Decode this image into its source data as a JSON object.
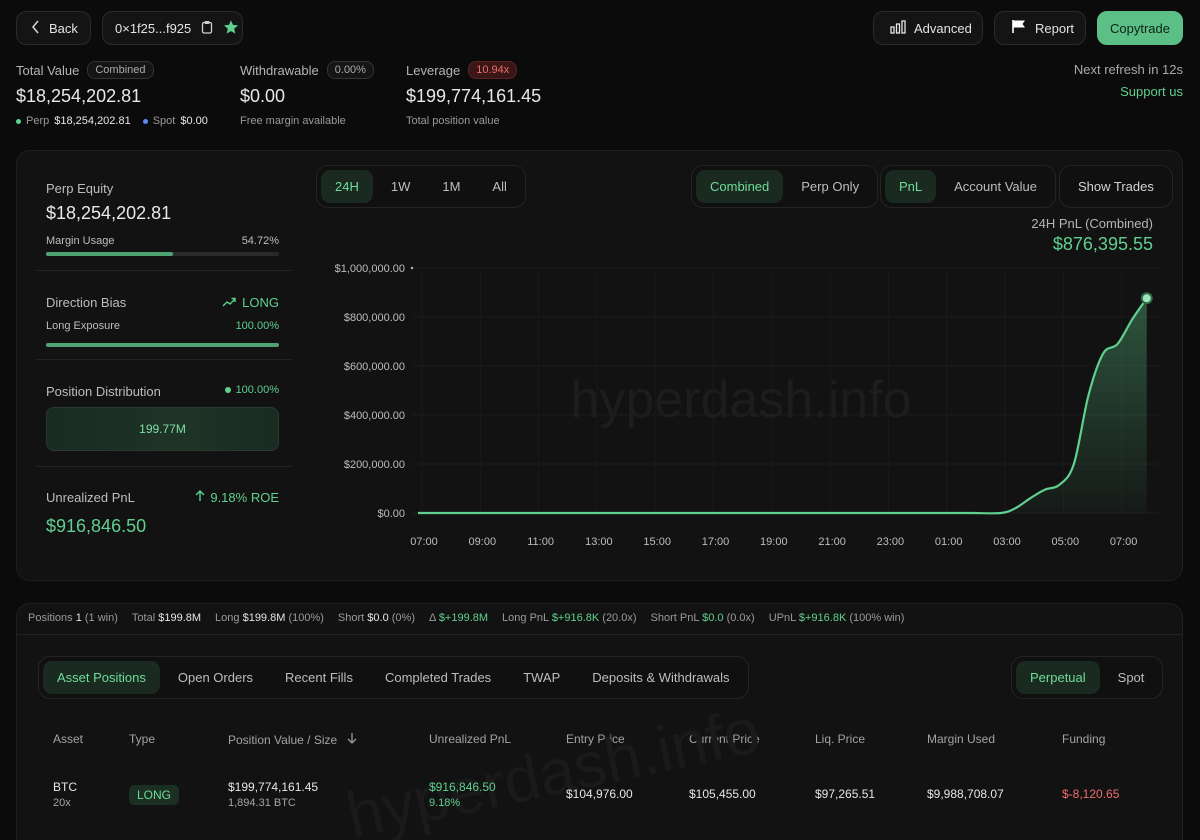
{
  "header": {
    "back_label": "Back",
    "address": "0×1f25...f925",
    "advanced_label": "Advanced",
    "report_label": "Report",
    "copytrade_label": "Copytrade"
  },
  "summary": {
    "total_value_label": "Total Value",
    "total_value_pill": "Combined",
    "total_value": "$18,254,202.81",
    "perp_label": "Perp",
    "perp_value": "$18,254,202.81",
    "spot_label": "Spot",
    "spot_value": "$0.00",
    "withdrawable_label": "Withdrawable",
    "withdrawable_pill": "0.00%",
    "withdrawable_value": "$0.00",
    "withdrawable_sub": "Free margin available",
    "leverage_label": "Leverage",
    "leverage_pill": "10.94x",
    "leverage_value": "$199,774,161.45",
    "leverage_sub": "Total position value",
    "refresh_text": "Next refresh in 12s",
    "support_text": "Support us"
  },
  "left_panel": {
    "perp_equity_label": "Perp Equity",
    "perp_equity_value": "$18,254,202.81",
    "margin_usage_label": "Margin Usage",
    "margin_usage_value": "54.72%",
    "margin_usage_fraction": 0.5472,
    "direction_bias_label": "Direction Bias",
    "direction_bias_value": "LONG",
    "long_exposure_label": "Long Exposure",
    "long_exposure_value": "100.00%",
    "long_exposure_fraction": 1.0,
    "position_distribution_label": "Position Distribution",
    "position_distribution_pct": "100.00%",
    "position_distribution_value": "199.77M",
    "unrealized_pnl_label": "Unrealized PnL",
    "unrealized_roe": "9.18% ROE",
    "unrealized_pnl_value": "$916,846.50"
  },
  "chart_controls": {
    "ranges": [
      "24H",
      "1W",
      "1M",
      "All"
    ],
    "active_range": "24H",
    "modes": [
      "Combined",
      "Perp Only"
    ],
    "active_mode": "Combined",
    "metrics": [
      "PnL",
      "Account Value"
    ],
    "active_metric": "PnL",
    "show_trades_label": "Show Trades",
    "pnl_title": "24H PnL (Combined)",
    "pnl_value": "$876,395.55",
    "watermark": "hyperdash.info"
  },
  "chart_data": {
    "type": "area",
    "x": [
      "07:00",
      "07:30",
      "08:00",
      "09:00",
      "10:00",
      "11:00",
      "12:00",
      "13:00",
      "14:00",
      "15:00",
      "16:00",
      "17:00",
      "18:00",
      "19:00",
      "20:00",
      "21:00",
      "22:00",
      "23:00",
      "00:00",
      "01:00",
      "02:00",
      "03:00",
      "03:30",
      "04:00",
      "04:30",
      "05:00",
      "05:30",
      "06:00",
      "06:30",
      "07:00",
      "07:30",
      "08:00"
    ],
    "values": [
      0,
      0,
      0,
      0,
      0,
      0,
      0,
      0,
      0,
      0,
      0,
      0,
      0,
      0,
      0,
      0,
      0,
      0,
      0,
      0,
      0,
      0,
      20000,
      60000,
      95000,
      115000,
      200000,
      480000,
      650000,
      690000,
      790000,
      876395.55
    ],
    "xticks": [
      "07:00",
      "09:00",
      "11:00",
      "13:00",
      "15:00",
      "17:00",
      "19:00",
      "21:00",
      "23:00",
      "01:00",
      "03:00",
      "05:00",
      "07:00"
    ],
    "yticks": [
      "$0.00",
      "$200,000.00",
      "$400,000.00",
      "$600,000.00",
      "$800,000.00",
      "$1,000,000.00"
    ],
    "ylim": [
      0,
      1000000
    ],
    "color": "#5fd08e"
  },
  "stats_bar": {
    "positions_label": "Positions",
    "positions_value": "1",
    "positions_sub": "(1 win)",
    "total_label": "Total",
    "total_value": "$199.8M",
    "long_label": "Long",
    "long_value": "$199.8M",
    "long_sub": "(100%)",
    "short_label": "Short",
    "short_value": "$0.0",
    "short_sub": "(0%)",
    "delta_label": "Δ",
    "delta_value": "$+199.8M",
    "long_pnl_label": "Long PnL",
    "long_pnl_value": "$+916.8K",
    "long_pnl_sub": "(20.0x)",
    "short_pnl_label": "Short PnL",
    "short_pnl_value": "$0.0",
    "short_pnl_sub": "(0.0x)",
    "upnl_label": "UPnL",
    "upnl_value": "$+916.8K",
    "upnl_sub": "(100% win)"
  },
  "tabs": {
    "items": [
      "Asset Positions",
      "Open Orders",
      "Recent Fills",
      "Completed Trades",
      "TWAP",
      "Deposits & Withdrawals"
    ],
    "active": "Asset Positions",
    "market": [
      "Perpetual",
      "Spot"
    ],
    "active_market": "Perpetual"
  },
  "table": {
    "headers": [
      "Asset",
      "Type",
      "Position Value / Size",
      "Unrealized PnL",
      "Entry Price",
      "Current Price",
      "Liq. Price",
      "Margin Used",
      "Funding"
    ],
    "rows": [
      {
        "asset": "BTC",
        "leverage": "20x",
        "type": "LONG",
        "position_value": "$199,774,161.45",
        "size": "1,894.31 BTC",
        "upnl": "$916,846.50",
        "upnl_pct": "9.18%",
        "entry": "$104,976.00",
        "current": "$105,455.00",
        "liq": "$97,265.51",
        "margin": "$9,988,708.07",
        "funding": "$-8,120.65"
      }
    ]
  }
}
